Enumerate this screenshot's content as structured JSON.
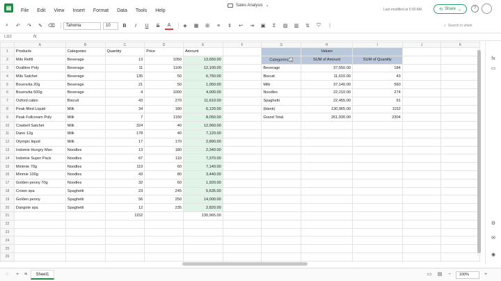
{
  "app": {
    "doc_title": "Sales Analysis",
    "last_modified": "Last modified at 5:00 AM",
    "share_label": "Share",
    "brand_color": "#1e8a43"
  },
  "menu": [
    "File",
    "Edit",
    "View",
    "Insert",
    "Format",
    "Data",
    "Tools",
    "Help"
  ],
  "toolbar": {
    "font_name": "Tahoma",
    "font_size": "10",
    "bold": "B",
    "italic": "I",
    "underline": "U",
    "strike": "S",
    "font_color": "A",
    "search_placeholder": "Search in sheet"
  },
  "formula": {
    "cell_ref": "L112",
    "fx": "fx"
  },
  "columns": [
    "A",
    "B",
    "C",
    "D",
    "E",
    "F",
    "G",
    "H",
    "I",
    "J",
    "K"
  ],
  "rows": [
    "1",
    "2",
    "3",
    "4",
    "5",
    "6",
    "7",
    "8",
    "9",
    "10",
    "11",
    "12",
    "13",
    "14",
    "15",
    "16",
    "17",
    "18",
    "19",
    "20",
    "21",
    "22",
    "23",
    "24",
    "25",
    "26",
    "27"
  ],
  "table": {
    "headers": [
      "Products",
      "Categories",
      "Quantity",
      "Price",
      "Amount"
    ],
    "data": [
      [
        "Milo Refill",
        "Beverage",
        "13",
        "1050",
        "13,650.00"
      ],
      [
        "Ovaltine Poly",
        "Beverage",
        "11",
        "1100",
        "12,100.00"
      ],
      [
        "Milo Satchet",
        "Beverage",
        "135",
        "50",
        "6,750.00"
      ],
      [
        "Bournvita 20g",
        "Beverage",
        "21",
        "50",
        "1,050.00"
      ],
      [
        "Bournvita 500g",
        "Beverage",
        "4",
        "1000",
        "4,000.00"
      ],
      [
        "Oxford cabin",
        "Biscuit",
        "43",
        "270",
        "11,610.00"
      ],
      [
        "Peak filled Liquid",
        "Milk",
        "34",
        "180",
        "6,120.00"
      ],
      [
        "Peak Fullcream Poly",
        "Milk",
        "7",
        "1150",
        "8,050.00"
      ],
      [
        "Cowbell Satchet",
        "Milk",
        "324",
        "40",
        "12,960.00"
      ],
      [
        "Dano 12g",
        "Milk",
        "178",
        "40",
        "7,120.00"
      ],
      [
        "Olympic liquid",
        "Milk",
        "17",
        "170",
        "2,890.00"
      ],
      [
        "Indomie Hungry Man",
        "Noodles",
        "13",
        "180",
        "2,340.00"
      ],
      [
        "Indomie Super Pack",
        "Noodles",
        "67",
        "110",
        "7,370.00"
      ],
      [
        "Minimie 70g",
        "Noodles",
        "119",
        "60",
        "7,140.00"
      ],
      [
        "Minmie 100g",
        "Noodles",
        "43",
        "80",
        "3,440.00"
      ],
      [
        "Golden penny 70g",
        "Noodles",
        "32",
        "60",
        "1,920.00"
      ],
      [
        "Crown spa",
        "Spaghetti",
        "23",
        "245",
        "5,635.00"
      ],
      [
        "Golden penny",
        "Spaghetti",
        "56",
        "250",
        "14,000.00"
      ],
      [
        "Dangote spa",
        "Spaghetti",
        "12",
        "235",
        "2,820.00"
      ]
    ],
    "totals": {
      "quantity": "1152",
      "amount": "130,965.00"
    }
  },
  "pivot": {
    "values_label": "Values",
    "headers": [
      "Categories",
      "SUM of  Amount",
      "SUM of Quantity"
    ],
    "rows": [
      [
        "Beverage",
        "37,550.00",
        "184"
      ],
      [
        "Biscuit",
        "11,610.00",
        "43"
      ],
      [
        "Milk",
        "37,140.00",
        "560"
      ],
      [
        "Noodles",
        "22,210.00",
        "274"
      ],
      [
        "Spaghetti",
        "22,455.00",
        "91"
      ],
      [
        "(blank)",
        "130,965.00",
        "1152"
      ]
    ],
    "grand_total": [
      "Grand Total",
      "261,930.00",
      "2304"
    ],
    "header_color": "#b9c8dc"
  },
  "status": {
    "sheet_name": "Sheet1",
    "zoom": "100%"
  }
}
